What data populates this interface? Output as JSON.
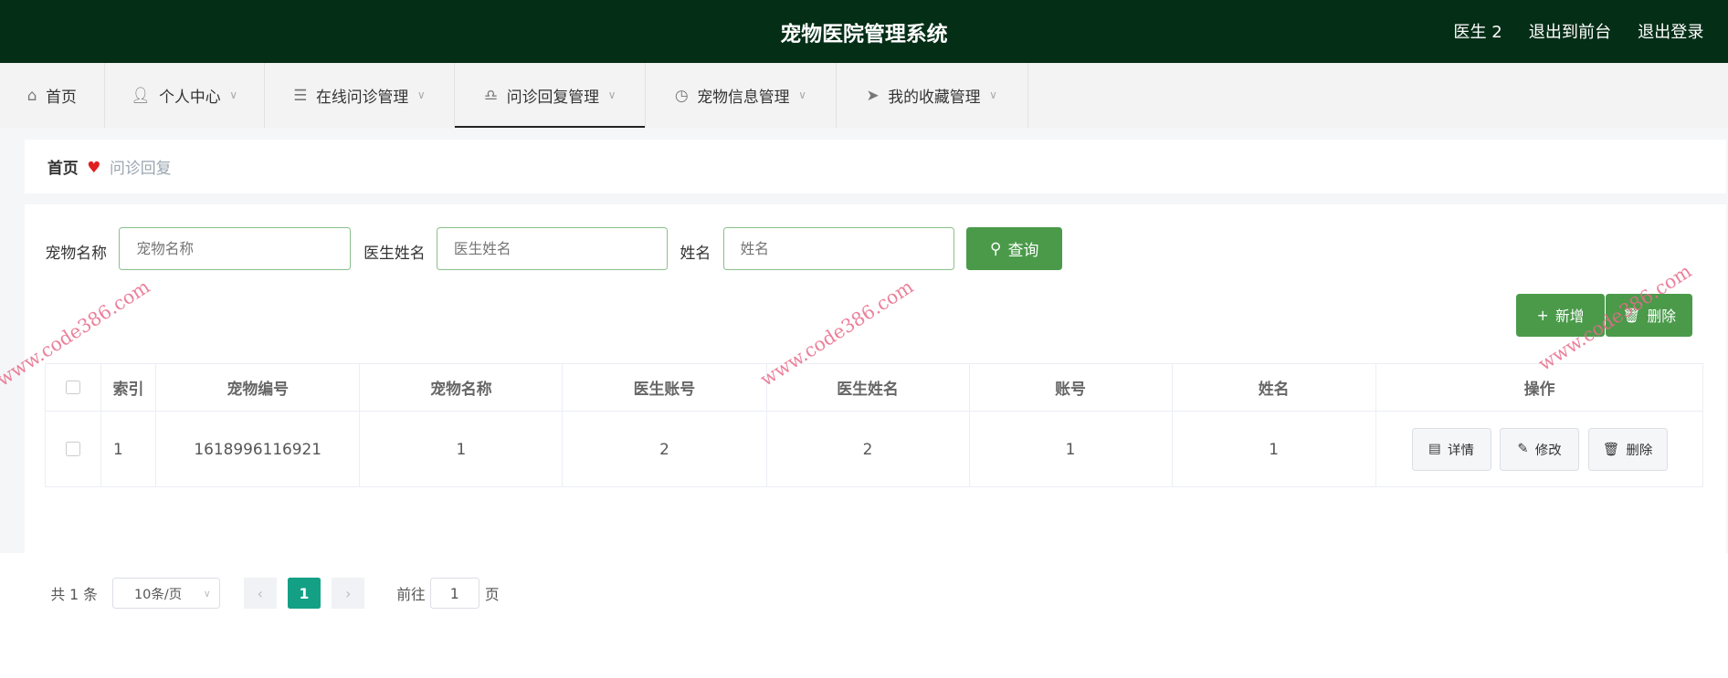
{
  "header": {
    "title": "宠物医院管理系统",
    "user": "医生 2",
    "back_front": "退出到前台",
    "logout": "退出登录"
  },
  "nav": [
    {
      "label": "首页",
      "icon": "home-icon"
    },
    {
      "label": "个人中心",
      "icon": "user-icon"
    },
    {
      "label": "在线问诊管理",
      "icon": "list-icon"
    },
    {
      "label": "问诊回复管理",
      "icon": "bell-icon"
    },
    {
      "label": "宠物信息管理",
      "icon": "clock-icon"
    },
    {
      "label": "我的收藏管理",
      "icon": "send-icon"
    }
  ],
  "breadcrumb": {
    "home": "首页",
    "current": "问诊回复"
  },
  "search": {
    "pet_name_label": "宠物名称",
    "pet_name_placeholder": "宠物名称",
    "doctor_name_label": "医生姓名",
    "doctor_name_placeholder": "医生姓名",
    "name_label": "姓名",
    "name_placeholder": "姓名",
    "query": "查询"
  },
  "actions": {
    "add": "新增",
    "delete": "删除"
  },
  "table": {
    "headers": [
      "索引",
      "宠物编号",
      "宠物名称",
      "医生账号",
      "医生姓名",
      "账号",
      "姓名",
      "操作"
    ],
    "rows": [
      {
        "cells": [
          "1",
          "1618996116921",
          "1",
          "2",
          "2",
          "1",
          "1"
        ]
      }
    ],
    "row_actions": {
      "detail": "详情",
      "edit": "修改",
      "delete": "删除"
    }
  },
  "pagination": {
    "total": "共 1 条",
    "page_size": "10条/页",
    "current": "1",
    "goto": "前往",
    "goto_value": "1",
    "page_suffix": "页"
  },
  "watermark": "www.code386.com",
  "colors": {
    "header": "#052e17",
    "primary": "#4a9a4a",
    "page_active": "#14a085"
  }
}
